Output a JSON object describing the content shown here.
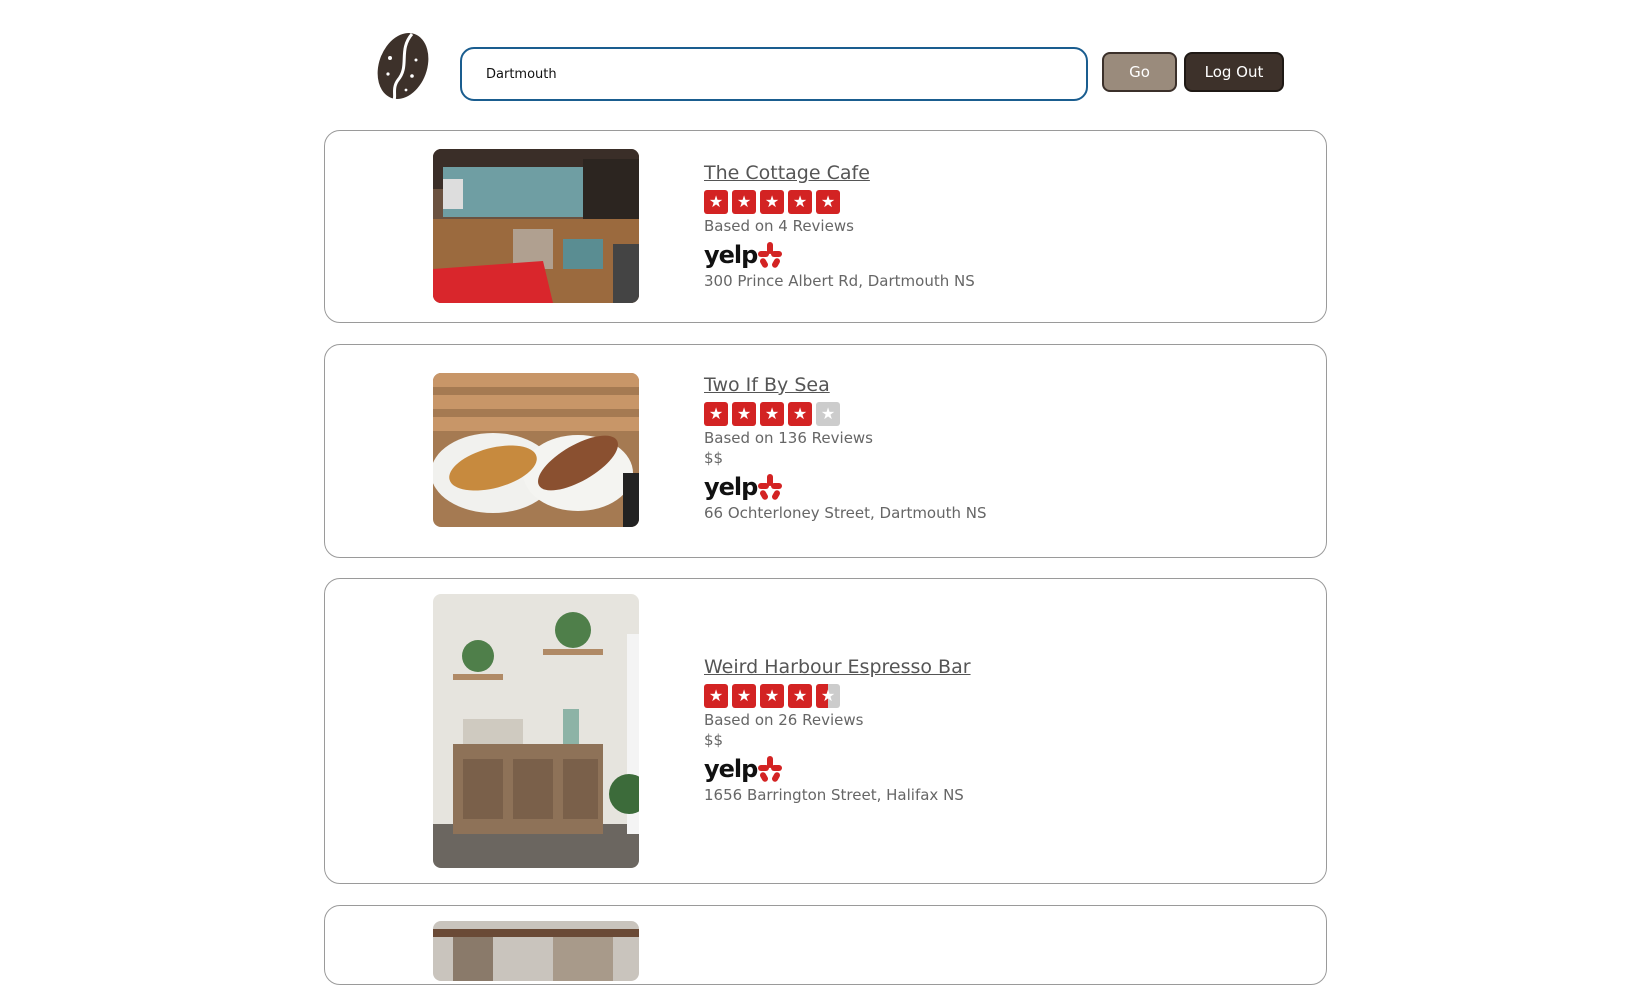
{
  "search": {
    "value": "Dartmouth",
    "go_label": "Go",
    "logout_label": "Log Out"
  },
  "logo": {
    "icon": "coffee-bean-icon",
    "color": "#3d312a"
  },
  "colors": {
    "yelp_red": "#d32323",
    "empty_star": "#cccccc",
    "go_button": "#9a8b7c",
    "logout_button": "#3d312a"
  },
  "results": [
    {
      "name": "The Cottage Cafe",
      "rating": 5,
      "review_text": "Based on 4 Reviews",
      "price": "",
      "brand": "yelp",
      "address": "300 Prince Albert Rd, Dartmouth NS",
      "image": "cafe-interior-photo"
    },
    {
      "name": "Two If By Sea",
      "rating": 4,
      "review_text": "Based on 136 Reviews",
      "price": "$$",
      "brand": "yelp",
      "address": "66 Ochterloney Street, Dartmouth NS",
      "image": "croissants-photo"
    },
    {
      "name": "Weird Harbour Espresso Bar",
      "rating": 4.5,
      "review_text": "Based on 26 Reviews",
      "price": "$$",
      "brand": "yelp",
      "address": "1656 Barrington Street, Halifax NS",
      "image": "cabinet-plants-photo"
    },
    {
      "image": "partial-cafe-photo"
    }
  ]
}
